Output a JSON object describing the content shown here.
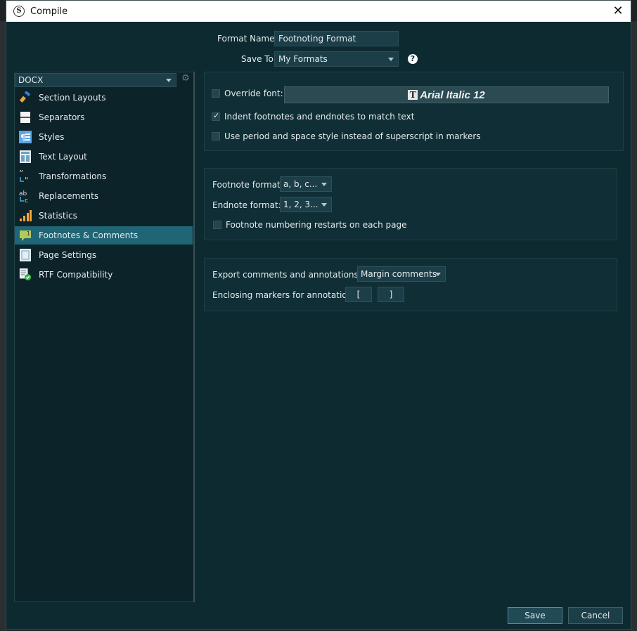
{
  "window": {
    "title": "Compile"
  },
  "header": {
    "format_name_label": "Format Name:",
    "format_name_value": "Footnoting Format",
    "save_to_label": "Save To:",
    "save_to_value": "My Formats"
  },
  "sidebar": {
    "format_type": "DOCX",
    "items": [
      {
        "label": "Section Layouts",
        "icon": "brush-icon"
      },
      {
        "label": "Separators",
        "icon": "separator-icon"
      },
      {
        "label": "Styles",
        "icon": "paragraph-icon"
      },
      {
        "label": "Text Layout",
        "icon": "layout-icon"
      },
      {
        "label": "Transformations",
        "icon": "quote-transform-icon"
      },
      {
        "label": "Replacements",
        "icon": "replace-icon"
      },
      {
        "label": "Statistics",
        "icon": "bar-chart-icon"
      },
      {
        "label": "Footnotes & Comments",
        "icon": "comment-icon",
        "active": true
      },
      {
        "label": "Page Settings",
        "icon": "page-icon"
      },
      {
        "label": "RTF Compatibility",
        "icon": "rtf-check-icon"
      }
    ]
  },
  "font_group": {
    "override_font_label": "Override font:",
    "override_font_checked": false,
    "font_button_label": "Arial Italic 12",
    "indent_label": "Indent footnotes and endnotes to match text",
    "indent_checked": true,
    "period_label": "Use period and space style instead of superscript in markers",
    "period_checked": false
  },
  "format_group": {
    "footnote_format_label": "Footnote format:",
    "footnote_format_value": "a, b, c...",
    "endnote_format_label": "Endnote format:",
    "endnote_format_value": "1, 2, 3...",
    "restart_label": "Footnote numbering restarts on each page",
    "restart_checked": false
  },
  "comments_group": {
    "export_label": "Export comments and annotations as:",
    "export_value": "Margin comments",
    "enclosing_label": "Enclosing markers for annotations:",
    "open_marker": "[",
    "close_marker": "]"
  },
  "footer": {
    "save_label": "Save",
    "cancel_label": "Cancel"
  },
  "colors": {
    "accent": "#1f6575",
    "background": "#0e2a31"
  }
}
